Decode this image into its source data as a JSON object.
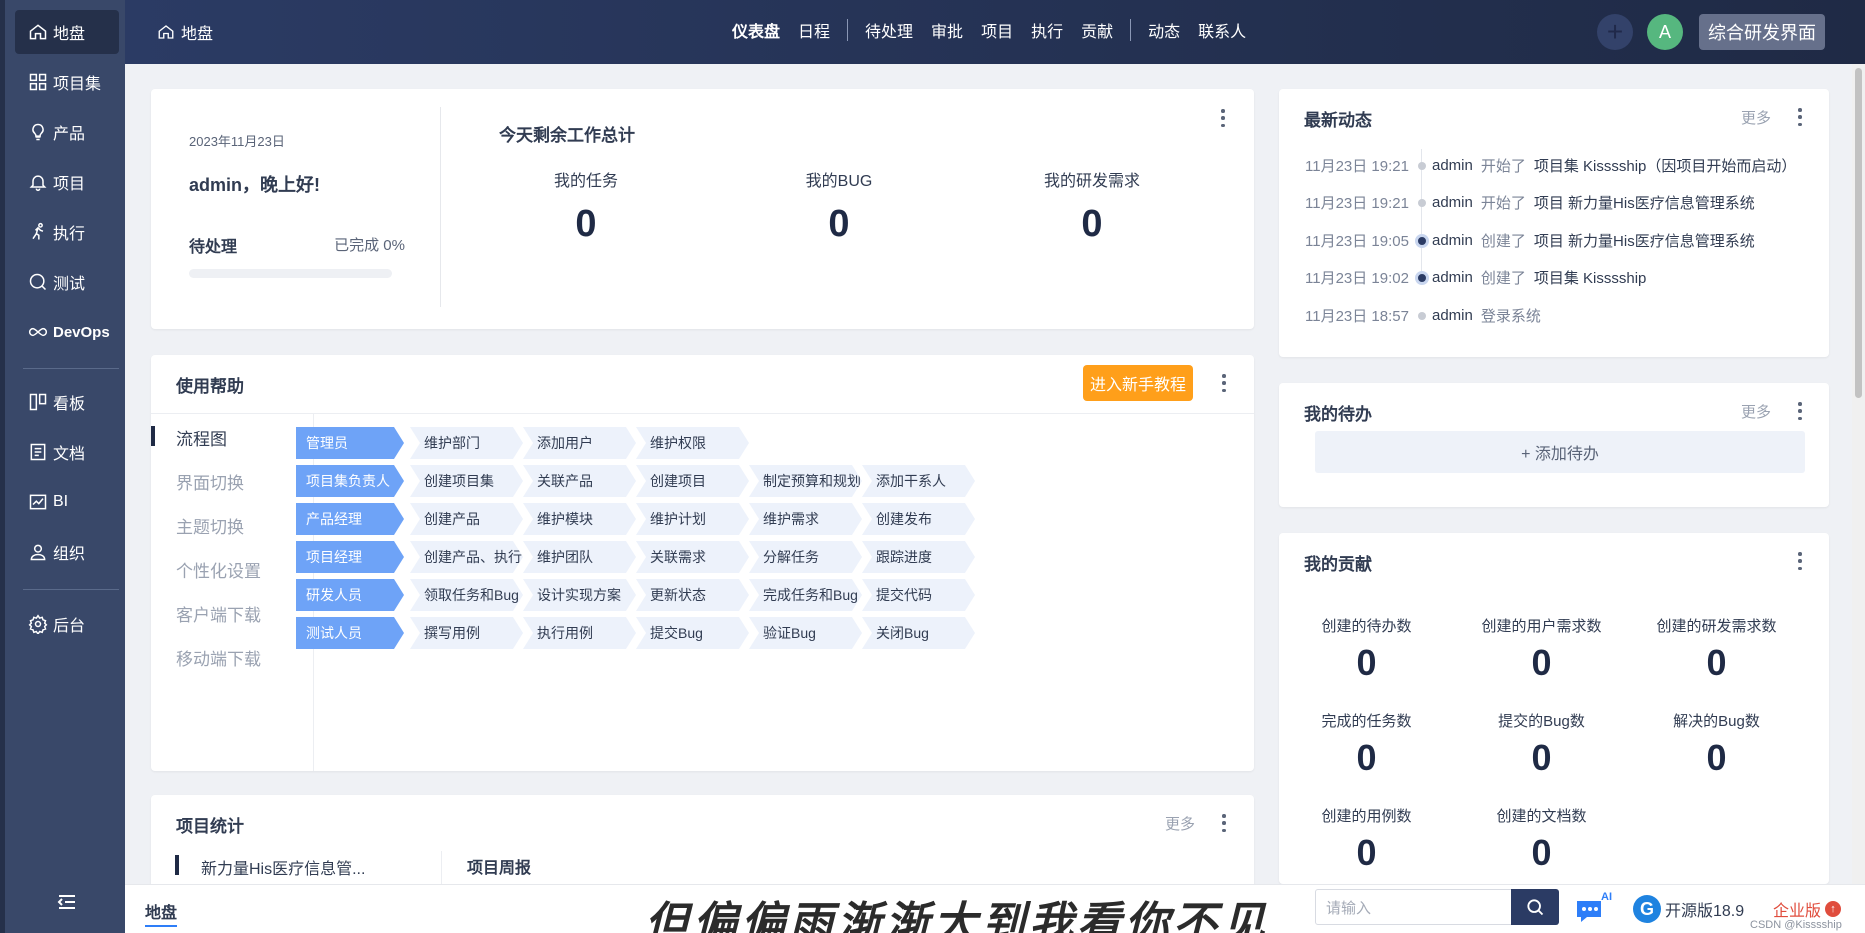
{
  "sidebar": {
    "items": [
      {
        "label": "地盘",
        "icon": "home-icon"
      },
      {
        "label": "项目集",
        "icon": "grid-icon"
      },
      {
        "label": "产品",
        "icon": "bulb-icon"
      },
      {
        "label": "项目",
        "icon": "bell-icon"
      },
      {
        "label": "执行",
        "icon": "run-icon"
      },
      {
        "label": "测试",
        "icon": "search-icon"
      },
      {
        "label": "DevOps",
        "icon": "infinity-icon"
      },
      {
        "label": "看板",
        "icon": "kanban-icon"
      },
      {
        "label": "文档",
        "icon": "doc-icon"
      },
      {
        "label": "BI",
        "icon": "chart-icon"
      },
      {
        "label": "组织",
        "icon": "user-icon"
      },
      {
        "label": "后台",
        "icon": "gear-icon"
      }
    ]
  },
  "header": {
    "breadcrumb": "地盘",
    "nav": [
      "仪表盘",
      "日程",
      "待处理",
      "审批",
      "项目",
      "执行",
      "贡献",
      "动态",
      "联系人"
    ],
    "avatar_letter": "A",
    "vision_button": "综合研发界面",
    "avatar_color": "#56b77f"
  },
  "summary": {
    "date": "2023年11月23日",
    "greeting": "admin，晚上好!",
    "pending_label": "待处理",
    "done_label": "已完成 0%",
    "progress": 0,
    "title": "今天剩余工作总计",
    "stats": [
      {
        "label": "我的任务",
        "value": "0"
      },
      {
        "label": "我的BUG",
        "value": "0"
      },
      {
        "label": "我的研发需求",
        "value": "0"
      }
    ]
  },
  "help": {
    "title": "使用帮助",
    "tutorial_button": "进入新手教程",
    "menu": [
      "流程图",
      "界面切换",
      "主题切换",
      "个性化设置",
      "客户端下载",
      "移动端下载"
    ],
    "rows": [
      {
        "role": "管理员",
        "steps": [
          "维护部门",
          "添加用户",
          "维护权限"
        ]
      },
      {
        "role": "项目集负责人",
        "steps": [
          "创建项目集",
          "关联产品",
          "创建项目",
          "制定预算和规划",
          "添加干系人"
        ]
      },
      {
        "role": "产品经理",
        "steps": [
          "创建产品",
          "维护模块",
          "维护计划",
          "维护需求",
          "创建发布"
        ]
      },
      {
        "role": "项目经理",
        "steps": [
          "创建产品、执行",
          "维护团队",
          "关联需求",
          "分解任务",
          "跟踪进度"
        ]
      },
      {
        "role": "研发人员",
        "steps": [
          "领取任务和Bug",
          "设计实现方案",
          "更新状态",
          "完成任务和Bug",
          "提交代码"
        ]
      },
      {
        "role": "测试人员",
        "steps": [
          "撰写用例",
          "执行用例",
          "提交Bug",
          "验证Bug",
          "关闭Bug"
        ]
      }
    ]
  },
  "project_stats": {
    "title": "项目统计",
    "more": "更多",
    "project_name": "新力量His医疗信息管...",
    "weekly": "项目周报"
  },
  "activity": {
    "title": "最新动态",
    "more": "更多",
    "items": [
      {
        "time": "11月23日 19:21",
        "user": "admin",
        "action": "开始了",
        "object": "项目集  Kisssship（因项目开始而启动）"
      },
      {
        "time": "11月23日 19:21",
        "user": "admin",
        "action": "开始了",
        "object": "项目  新力量His医疗信息管理系统"
      },
      {
        "time": "11月23日 19:05",
        "user": "admin",
        "action": "创建了",
        "object": "项目  新力量His医疗信息管理系统"
      },
      {
        "time": "11月23日 19:02",
        "user": "admin",
        "action": "创建了",
        "object": "项目集  Kisssship"
      },
      {
        "time": "11月23日 18:57",
        "user": "admin",
        "action": "登录系统",
        "object": ""
      }
    ]
  },
  "todo": {
    "title": "我的待办",
    "more": "更多",
    "add": "+ 添加待办"
  },
  "contribution": {
    "title": "我的贡献",
    "items": [
      {
        "label": "创建的待办数",
        "value": "0"
      },
      {
        "label": "创建的用户需求数",
        "value": "0"
      },
      {
        "label": "创建的研发需求数",
        "value": "0"
      },
      {
        "label": "完成的任务数",
        "value": "0"
      },
      {
        "label": "提交的Bug数",
        "value": "0"
      },
      {
        "label": "解决的Bug数",
        "value": "0"
      },
      {
        "label": "创建的用例数",
        "value": "0"
      },
      {
        "label": "创建的文档数",
        "value": "0"
      }
    ]
  },
  "bottom": {
    "tab": "地盘",
    "watermark": "但偏偏雨渐渐大到我看你不见",
    "search_placeholder": "请输入",
    "ai_label": "AI",
    "version": "开源版18.9",
    "logo_letter": "G",
    "enterprise": "企业版",
    "enterprise_badge": "↑",
    "csdn": "CSDN @Kisssship"
  }
}
